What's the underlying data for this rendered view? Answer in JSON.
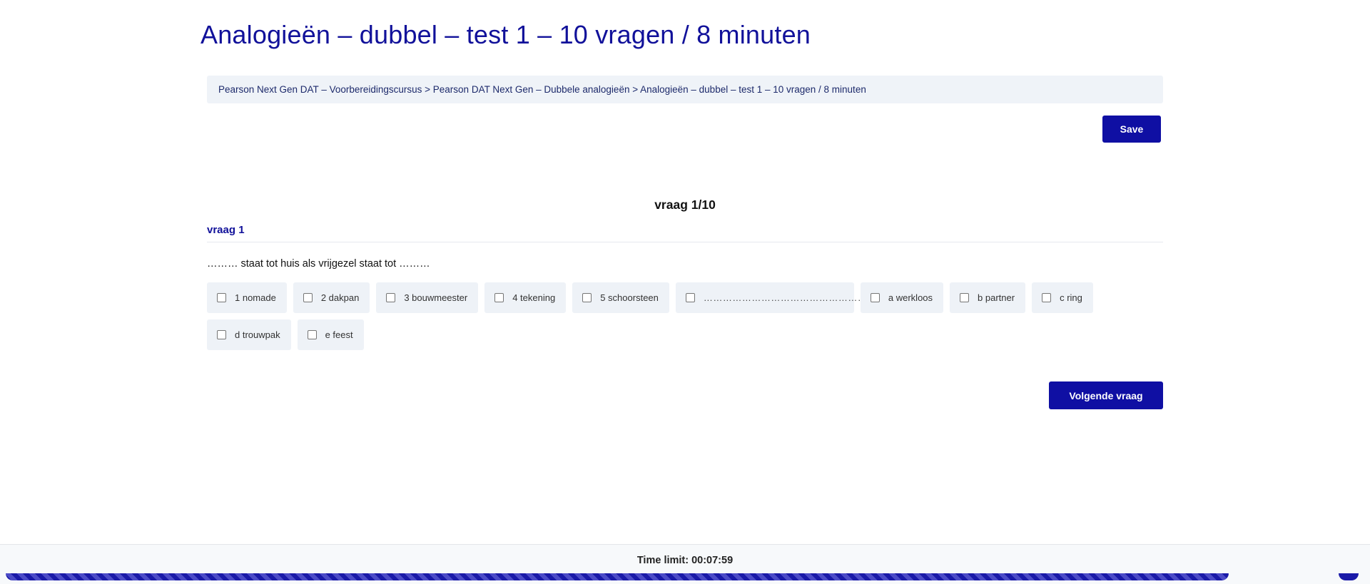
{
  "header": {
    "title": "Analogieën – dubbel – test 1 – 10 vragen / 8 minuten"
  },
  "breadcrumb": {
    "text": "Pearson Next Gen DAT – Voorbereidingscursus > Pearson DAT Next Gen – Dubbele analogieën > Analogieën – dubbel – test 1 – 10 vragen / 8 minuten"
  },
  "toolbar": {
    "save_label": "Save"
  },
  "quiz": {
    "counter": "vraag 1/10",
    "question_label": "vraag 1",
    "question_text": "……… staat tot huis als vrijgezel staat tot ………",
    "options": [
      "1 nomade",
      "2 dakpan",
      "3 bouwmeester",
      "4 tekening",
      "5 schoorsteen",
      "……………………………………………………",
      "a werkloos",
      "b partner",
      "c ring",
      "d trouwpak",
      "e feest"
    ],
    "next_label": "Volgende vraag"
  },
  "footer": {
    "timer": "Time limit: 00:07:59",
    "progress_fraction": 0.9
  },
  "colors": {
    "accent": "#0f0fa3",
    "title": "#11119a",
    "option_bg": "#eef2f7"
  }
}
